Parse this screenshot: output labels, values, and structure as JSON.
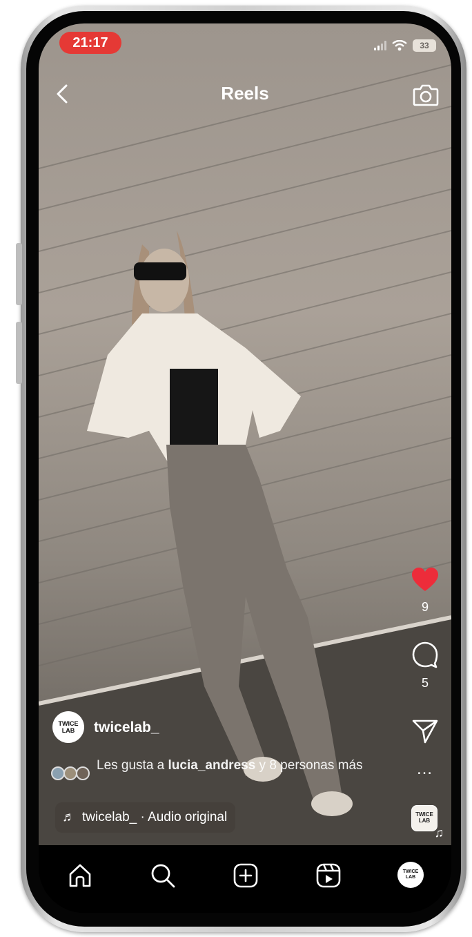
{
  "status_bar": {
    "time": "21:17",
    "battery": "33"
  },
  "header": {
    "title": "Reels"
  },
  "actions": {
    "like_count": "9",
    "comment_count": "5",
    "more": "…"
  },
  "post": {
    "username": "twicelab_",
    "avatar_text_1": "TWICE",
    "avatar_text_2": "LAB",
    "likes_prefix": "Les gusta a ",
    "likes_user": "lucia_andress",
    "likes_suffix": " y 8 personas más",
    "audio_icon": "♬",
    "audio_label": "twicelab_ · Audio original"
  },
  "audio_thumb": {
    "line1": "TWICE",
    "line2": "LAB"
  },
  "tabbar": {
    "profile_line1": "TWICE",
    "profile_line2": "LAB"
  },
  "colors": {
    "accent_red": "#ed2c3a",
    "time_pill": "#e53935"
  }
}
